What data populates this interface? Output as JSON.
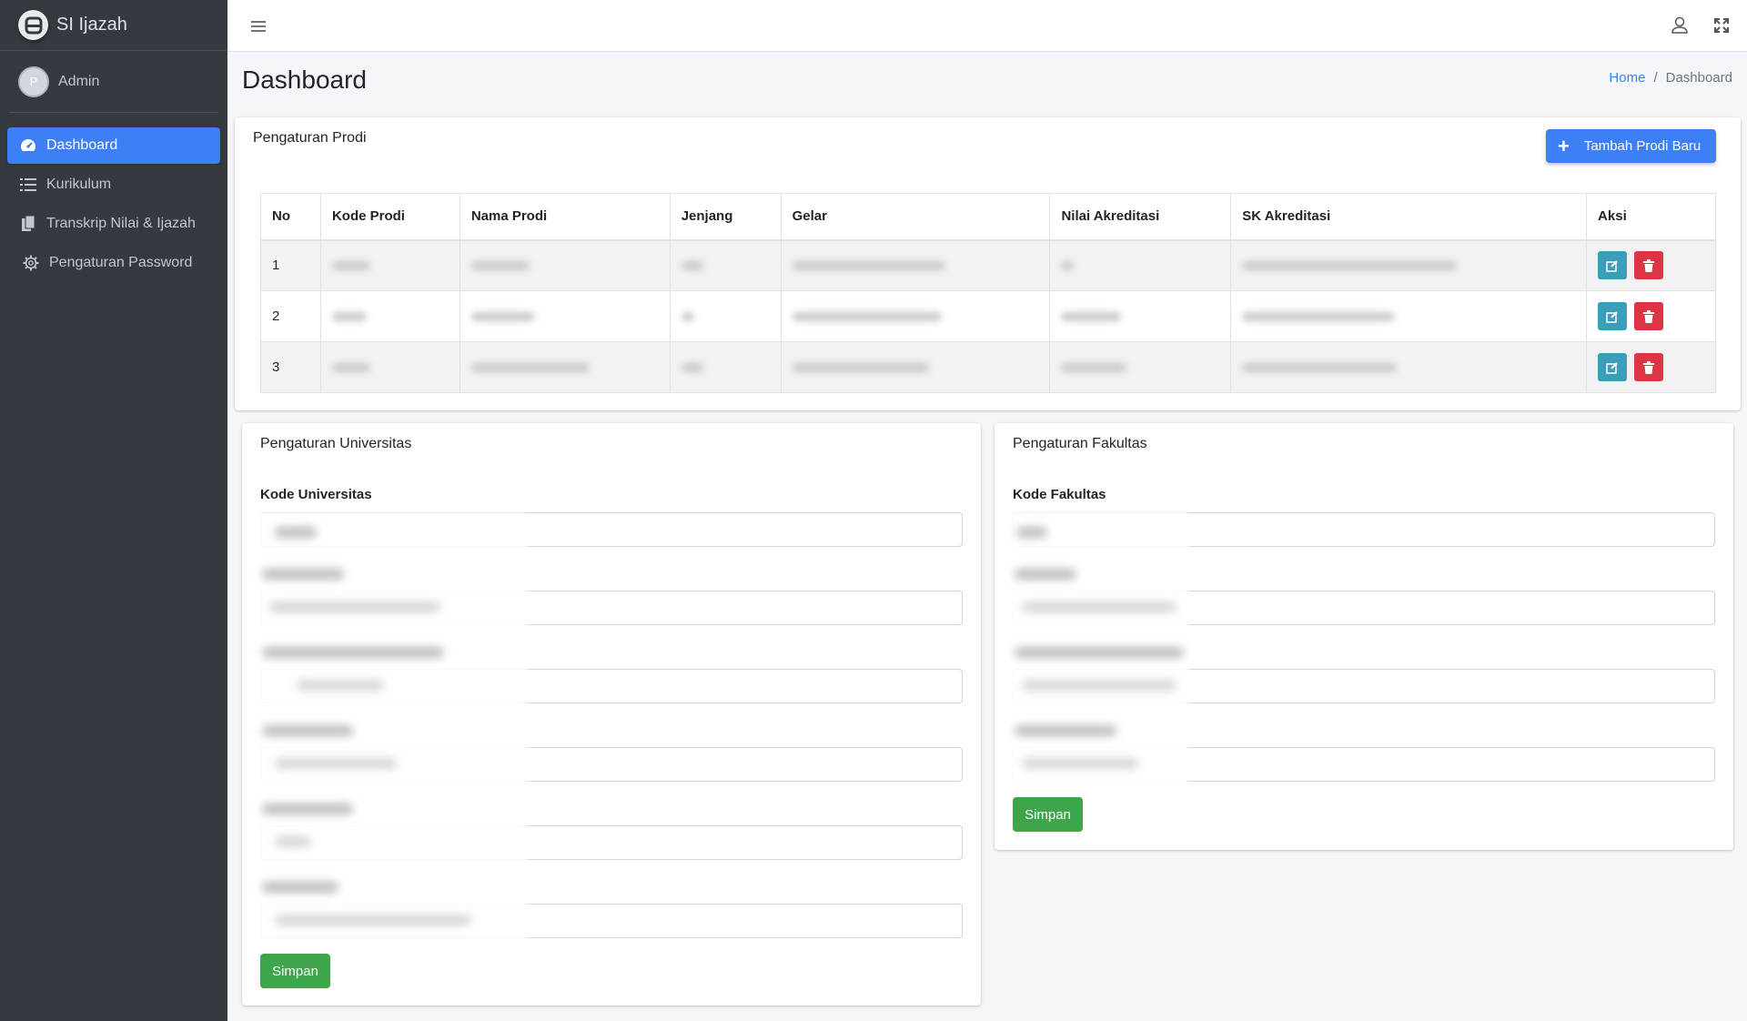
{
  "brand": {
    "title": "SI Ijazah"
  },
  "user": {
    "name": "Admin",
    "initial": "P"
  },
  "sidebar": {
    "items": [
      {
        "label": "Dashboard",
        "icon": "tachometer-icon",
        "active": true
      },
      {
        "label": "Kurikulum",
        "icon": "list-icon"
      },
      {
        "label": "Transkrip Nilai & Ijazah",
        "icon": "copy-icon"
      },
      {
        "label": "Pengaturan Password",
        "icon": "gear-icon"
      }
    ]
  },
  "header": {
    "title": "Dashboard",
    "breadcrumb": {
      "home": "Home",
      "separator": "/",
      "current": "Dashboard"
    }
  },
  "prodi": {
    "title": "Pengaturan Prodi",
    "add_button": "Tambah Prodi Baru",
    "columns": [
      "No",
      "Kode Prodi",
      "Nama Prodi",
      "Jenjang",
      "Gelar",
      "Nilai Akreditasi",
      "SK Akreditasi",
      "Aksi"
    ],
    "rows": [
      {
        "no": "1"
      },
      {
        "no": "2"
      },
      {
        "no": "3"
      }
    ]
  },
  "universitas": {
    "title": "Pengaturan Universitas",
    "first_label": "Kode Universitas",
    "save_button": "Simpan"
  },
  "fakultas": {
    "title": "Pengaturan Fakultas",
    "first_label": "Kode Fakultas",
    "save_button": "Simpan"
  },
  "colors": {
    "primary": "#3f7ff5",
    "success": "#3fa54a",
    "danger": "#dc3545",
    "info": "#3c9dbb",
    "sidebar": "#343a40"
  }
}
